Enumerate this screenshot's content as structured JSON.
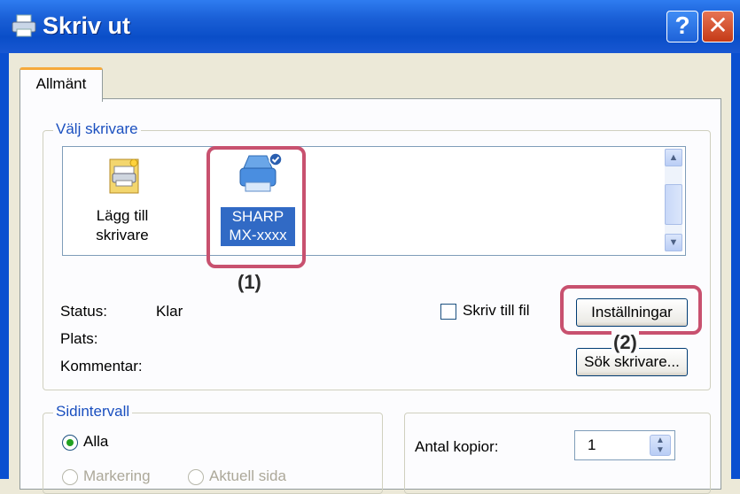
{
  "window": {
    "title": "Skriv ut",
    "help_label": "?",
    "close_label": "✕"
  },
  "tabs": [
    {
      "label": "Allmänt"
    }
  ],
  "printer_group": {
    "label": "Välj skrivare",
    "items": [
      {
        "label_line1": "Lägg till",
        "label_line2": "skrivare",
        "icon": "add-printer-icon",
        "selected": false
      },
      {
        "label_line1": "SHARP",
        "label_line2": "MX-xxxx",
        "icon": "printer-icon",
        "selected": true
      }
    ],
    "status_label": "Status:",
    "status_value": "Klar",
    "location_label": "Plats:",
    "comment_label": "Kommentar:",
    "print_to_file_label": "Skriv till fil",
    "settings_button": "Inställningar",
    "find_printer_button": "Sök skrivare..."
  },
  "page_range": {
    "label": "Sidintervall",
    "all_label": "Alla",
    "selection_label": "Markering",
    "current_page_label": "Aktuell sida"
  },
  "copies": {
    "label": "Antal kopior:",
    "value": "1"
  },
  "annotations": {
    "callout1": "(1)",
    "callout2": "(2)"
  },
  "colors": {
    "highlight": "#c8516f",
    "titlebar": "#0a4ec8",
    "group_label": "#1a4fbf"
  }
}
